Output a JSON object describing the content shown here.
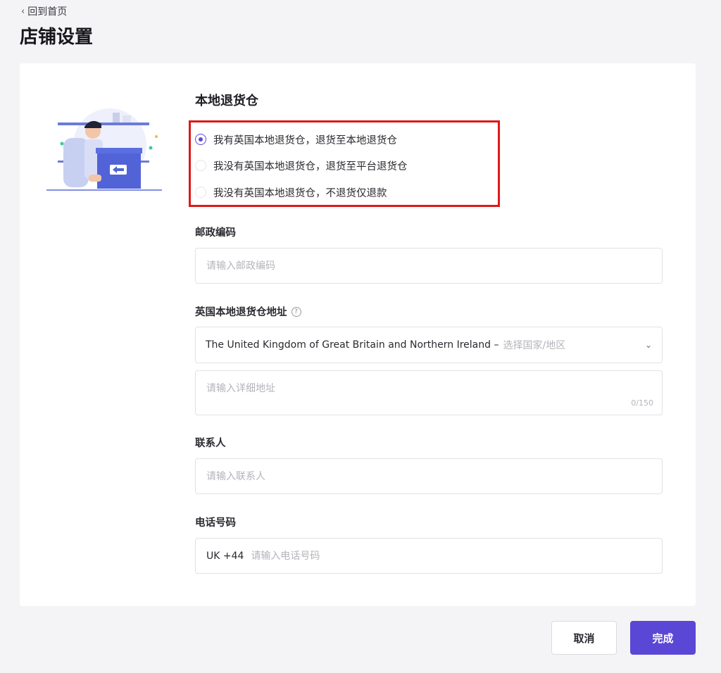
{
  "header": {
    "back_label": "回到首页",
    "title": "店铺设置"
  },
  "section": {
    "title": "本地退货仓",
    "options": [
      {
        "label": "我有英国本地退货仓，退货至本地退货仓",
        "checked": true
      },
      {
        "label": "我没有英国本地退货仓，退货至平台退货仓",
        "checked": false
      },
      {
        "label": "我没有英国本地退货仓，不退货仅退款",
        "checked": false
      }
    ]
  },
  "postcode": {
    "label": "邮政编码",
    "placeholder": "请输入邮政编码"
  },
  "address": {
    "label": "英国本地退货仓地址",
    "country_value": "The United Kingdom of Great Britain and Northern Ireland –",
    "country_placeholder": "选择国家/地区",
    "detail_placeholder": "请输入详细地址",
    "counter": "0/150"
  },
  "contact": {
    "label": "联系人",
    "placeholder": "请输入联系人"
  },
  "phone": {
    "label": "电话号码",
    "prefix": "UK +44",
    "placeholder": "请输入电话号码"
  },
  "footer": {
    "cancel_label": "取消",
    "done_label": "完成"
  },
  "colors": {
    "accent": "#5a47d6",
    "highlight": "#e01818"
  }
}
